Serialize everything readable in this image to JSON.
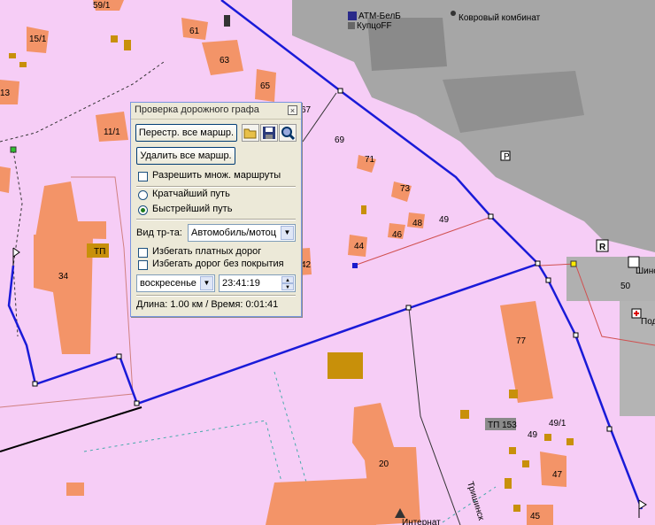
{
  "map": {
    "house_numbers": [
      "59/1",
      "15/1",
      "61",
      "63",
      "65",
      "67",
      "13",
      "11/1",
      "69",
      "71",
      "73",
      "48",
      "49",
      "46",
      "44",
      "42",
      "34",
      "77",
      "50",
      "49/1",
      "49",
      "47",
      "45",
      "20"
    ],
    "poi": {
      "atm": "АТМ-БелБ",
      "shop": "КупцоFF",
      "kovrovy": "Ковровый комбинат",
      "tp": "ТП",
      "tp153": "ТП 153",
      "internet": "Интернат",
      "shino": "Шино",
      "poda": "Пода",
      "street": "Тришинск",
      "r_sign": "R",
      "p_sign": "P"
    }
  },
  "dialog": {
    "title": "Проверка дорожного графа",
    "rebuild_all_label": "Перестр. все маршр.",
    "delete_all_label": "Удалить все маршр.",
    "allow_multiple_label": "Разрешить множ. маршруты",
    "shortest_label": "Кратчайший путь",
    "fastest_label": "Быстрейший путь",
    "vehicle_label": "Вид тр-та:",
    "vehicle_value": "Автомобиль/мотоц",
    "avoid_toll_label": "Избегать платных дорог",
    "avoid_unpaved_label": "Избегать дорог без покрытия",
    "day_value": "воскресенье",
    "time_value": "23:41:19",
    "status": "Длина: 1.00 км / Время: 0:01:41"
  }
}
